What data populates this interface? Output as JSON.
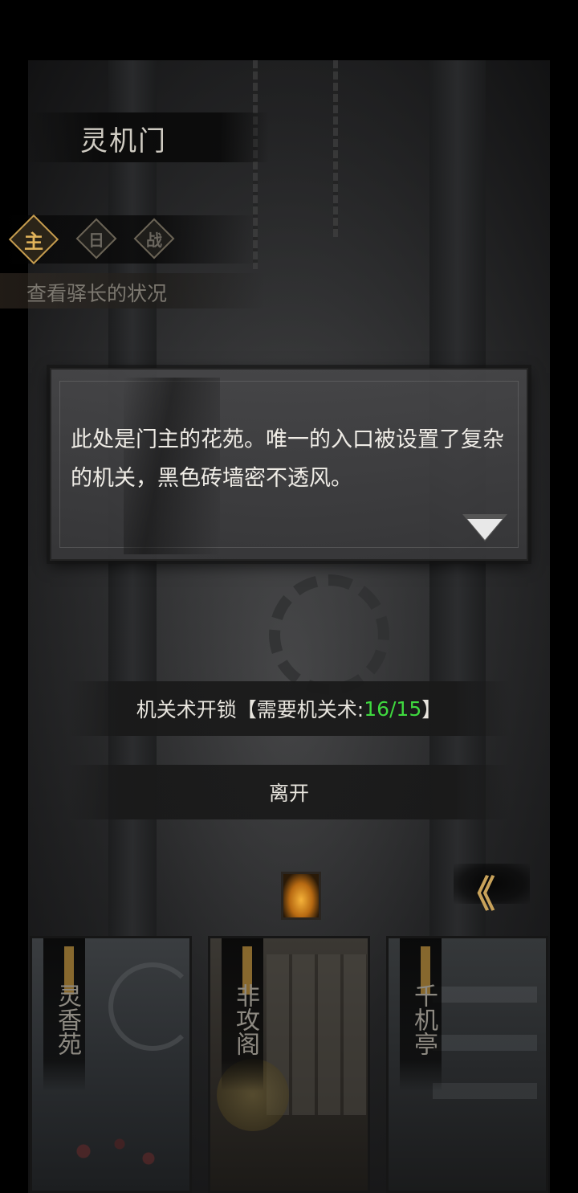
{
  "location": {
    "title": "灵机门"
  },
  "tabs": [
    {
      "label": "主",
      "active": true
    },
    {
      "label": "日",
      "active": false
    },
    {
      "label": "战",
      "active": false
    }
  ],
  "quest": {
    "text": "查看驿长的状况"
  },
  "dialog": {
    "text": "此处是门主的花苑。唯一的入口被设置了复杂的机关，黑色砖墙密不透风。"
  },
  "options": [
    {
      "prefix": "机关术开锁【需要机关术:",
      "stat_value": "16/15",
      "suffix": "】",
      "stat_color": "#3fd93f"
    },
    {
      "label": "离开"
    }
  ],
  "back_button": {
    "icon": "double-chevron-left-icon",
    "glyph": "《"
  },
  "destinations": [
    {
      "label": "灵香苑"
    },
    {
      "label": "非攻阁"
    },
    {
      "label": "千机亭"
    }
  ],
  "colors": {
    "accent_gold": "#c8a25a",
    "stat_ok": "#3fd93f",
    "dialog_bg": "#464648"
  }
}
